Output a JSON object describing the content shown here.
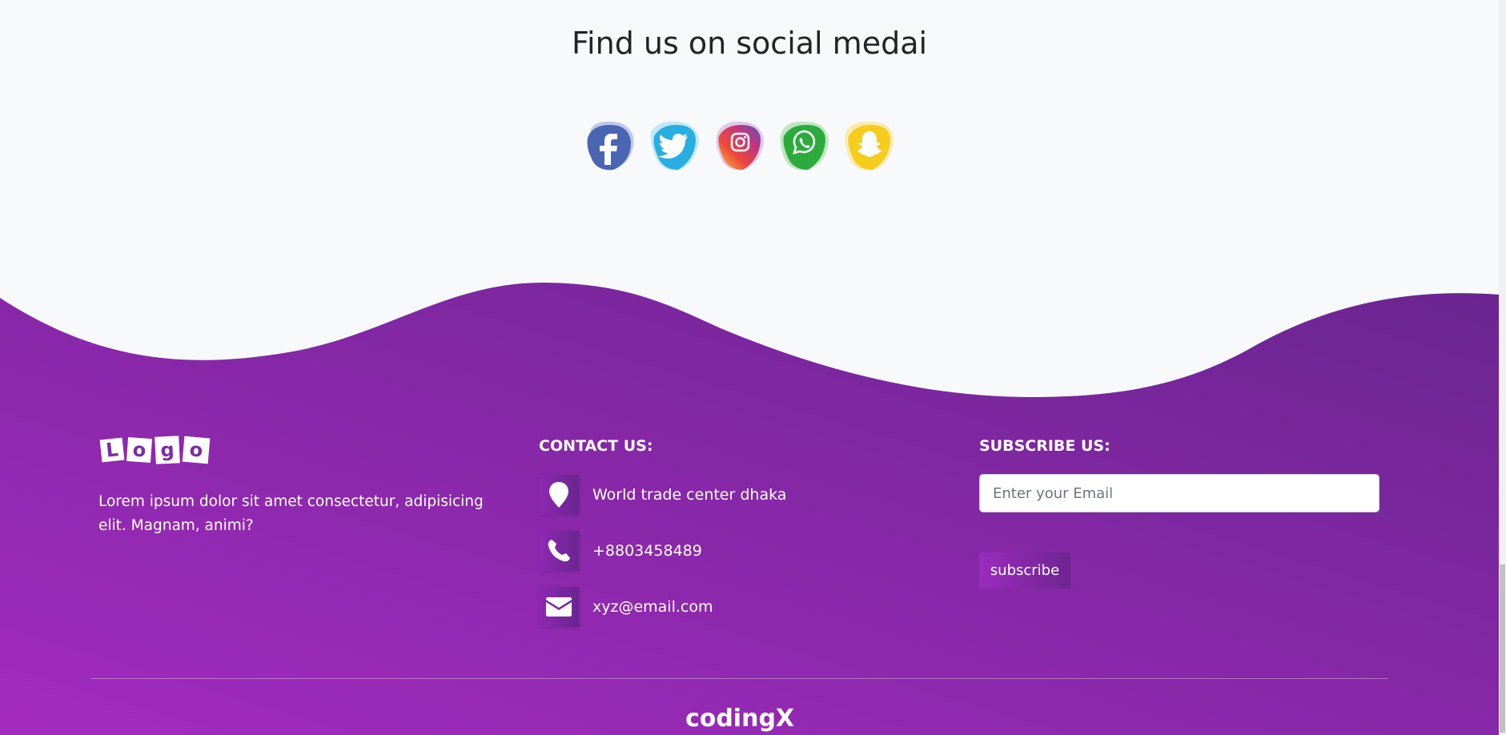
{
  "social": {
    "title": "Find us on social medai",
    "icons": [
      "facebook-icon",
      "twitter-icon",
      "instagram-icon",
      "whatsapp-icon",
      "snapchat-icon"
    ]
  },
  "footer": {
    "logo_letters": [
      "L",
      "o",
      "g",
      "o"
    ],
    "about_text": "Lorem ipsum dolor sit amet consectetur, adipisicing elit. Magnam, animi?",
    "contact": {
      "heading": "CONTACT US:",
      "address": "World trade center dhaka",
      "phone": "+8803458489",
      "email": "xyz@email.com"
    },
    "subscribe": {
      "heading": "SUBSCRIBE US:",
      "placeholder": "Enter your Email",
      "button_label": "subscribe"
    },
    "brand": "codingX"
  },
  "colors": {
    "gradient_start": "#a32bbf",
    "gradient_end": "#6a2590",
    "background": "#f8f9fa"
  }
}
